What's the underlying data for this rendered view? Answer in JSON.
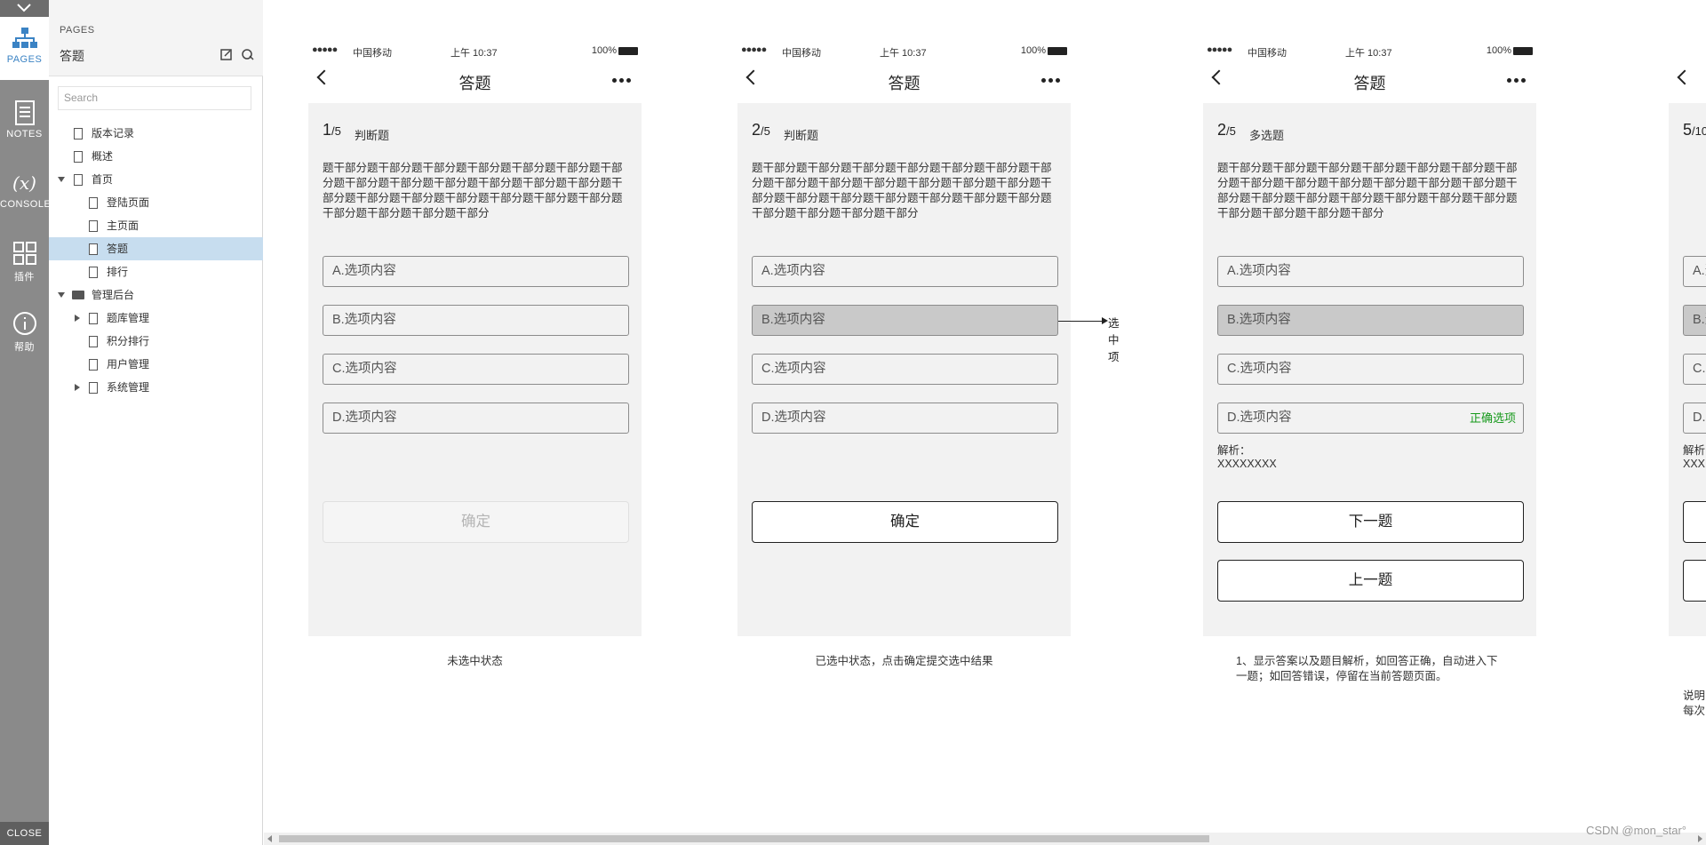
{
  "rail": {
    "items": [
      {
        "label": "PAGES",
        "icon": "sitemap-icon"
      },
      {
        "label": "NOTES",
        "icon": "notes-icon"
      },
      {
        "label": "CONSOLE",
        "icon": "variable-icon",
        "glyph": "(x)"
      },
      {
        "label": "插件",
        "icon": "grid-icon"
      },
      {
        "label": "帮助",
        "icon": "info-icon"
      }
    ],
    "close": "CLOSE"
  },
  "panel": {
    "caption": "PAGES",
    "title": "答题",
    "search_placeholder": "Search",
    "tree": [
      {
        "label": "版本记录"
      },
      {
        "label": "概述"
      },
      {
        "label": "首页"
      },
      {
        "label": "登陆页面"
      },
      {
        "label": "主页面"
      },
      {
        "label": "答题"
      },
      {
        "label": "排行"
      },
      {
        "label": "管理后台"
      },
      {
        "label": "题库管理"
      },
      {
        "label": "积分排行"
      },
      {
        "label": "用户管理"
      },
      {
        "label": "系统管理"
      }
    ]
  },
  "status": {
    "signal": "●●●●●",
    "carrier": "中国移动",
    "time": "上午 10:37",
    "battery": "100%"
  },
  "nav_title": "答题",
  "question_text": "题干部分题干部分题干部分题干部分题干部分题干部分题干部分题干部分题干部分题干部分题干部分题干部分题干部分题干部分题干部分题干部分题干部分题干部分题干部分题干部分题干部分题干部分题干部分题干部分",
  "options": [
    "A.选项内容",
    "B.选项内容",
    "C.选项内容",
    "D.选项内容"
  ],
  "phones": [
    {
      "qno": "1",
      "total": "/5",
      "type": "判断题",
      "confirm": "确定",
      "caption": "未选中状态"
    },
    {
      "qno": "2",
      "total": "/5",
      "type": "判断题",
      "confirm": "确定",
      "caption": "已选中状态，点击确定提交选中结果",
      "annotation": "选中项"
    },
    {
      "qno": "2",
      "total": "/5",
      "type": "多选题",
      "correct": "正确选项",
      "analysis_label": "解析：",
      "analysis_value": "XXXXXXXX",
      "next": "下一题",
      "prev": "上一题",
      "caption": "1、显示答案以及题目解析，如回答正确，自动进入下一题；如回答错误，停留在当前答题页面。"
    },
    {
      "qno": "5",
      "total": "/10",
      "analysis_label": "解析：",
      "analysis_value": "XXX",
      "caption_1": "说明",
      "caption_2": "每次"
    }
  ],
  "watermark": "CSDN @mon_star°"
}
